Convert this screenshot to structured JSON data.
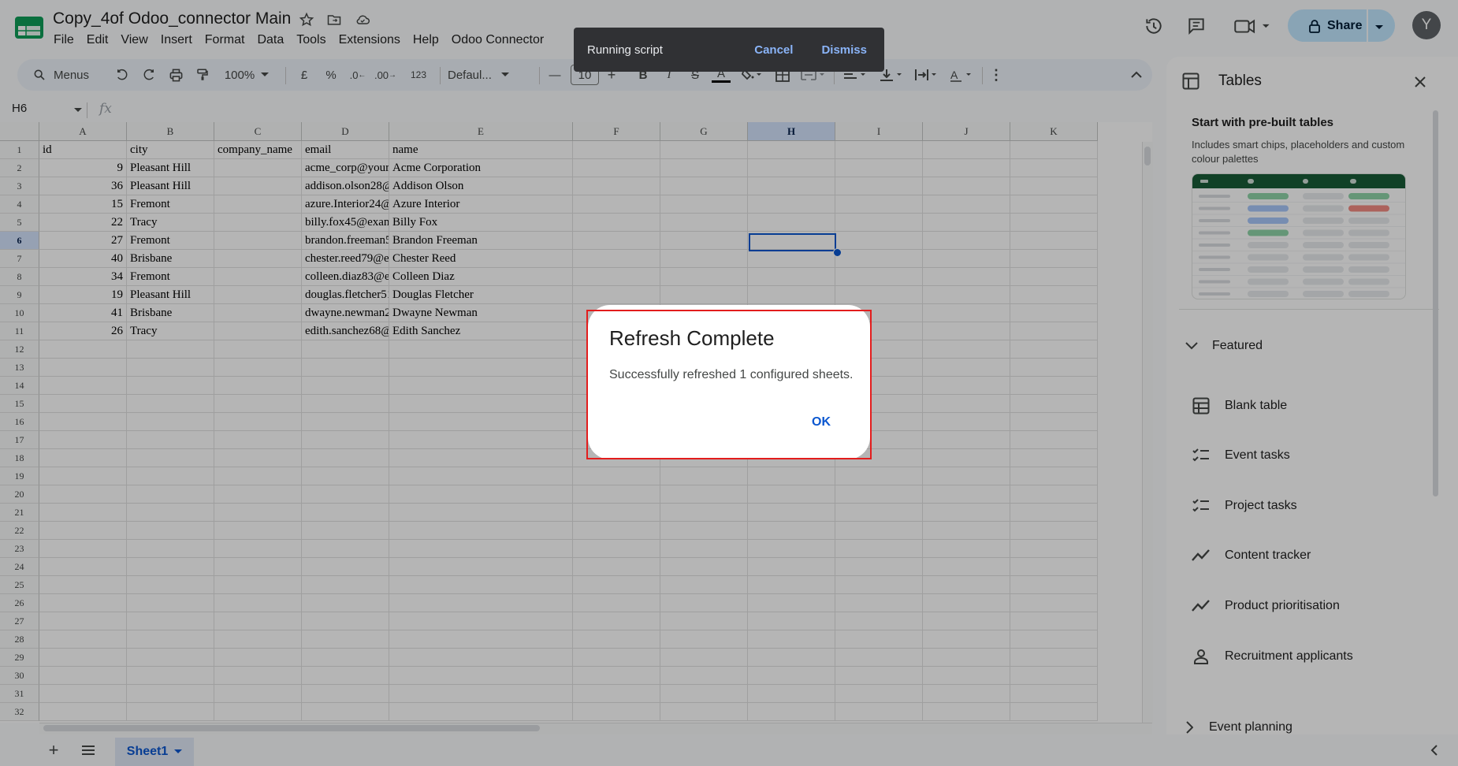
{
  "app": {
    "title": "Copy_4of Odoo_connector Main",
    "menus": [
      "File",
      "Edit",
      "View",
      "Insert",
      "Format",
      "Data",
      "Tools",
      "Extensions",
      "Help",
      "Odoo Connector"
    ],
    "share_label": "Share",
    "avatar_initial": "Y",
    "accent": "#0b57d0"
  },
  "toolbar": {
    "search_label": "Menus",
    "zoom": "100%",
    "currency": "£",
    "percent": "%",
    "dec_decrease": ".0",
    "dec_increase": ".00",
    "number_format": "123",
    "font_name": "Defaul...",
    "font_size": "10"
  },
  "formula_bar": {
    "name_box": "H6",
    "fx": "fx"
  },
  "grid": {
    "columns": [
      "A",
      "B",
      "C",
      "D",
      "E",
      "F",
      "G",
      "H",
      "I",
      "J",
      "K"
    ],
    "selected_column": "H",
    "selected_row": "6",
    "rows": [
      [
        "id",
        "city",
        "company_name",
        "email",
        "name"
      ],
      [
        "9",
        "Pleasant Hill",
        "",
        "acme_corp@your",
        "Acme Corporation"
      ],
      [
        "36",
        "Pleasant Hill",
        "",
        "addison.olson28@",
        "Addison Olson"
      ],
      [
        "15",
        "Fremont",
        "",
        "azure.Interior24@",
        "Azure Interior"
      ],
      [
        "22",
        "Tracy",
        "",
        "billy.fox45@exam",
        "Billy Fox"
      ],
      [
        "27",
        "Fremont",
        "",
        "brandon.freeman5",
        "Brandon Freeman"
      ],
      [
        "40",
        "Brisbane",
        "",
        "chester.reed79@e:",
        "Chester Reed"
      ],
      [
        "34",
        "Fremont",
        "",
        "colleen.diaz83@e:",
        "Colleen Diaz"
      ],
      [
        "19",
        "Pleasant Hill",
        "",
        "douglas.fletcher51",
        "Douglas Fletcher"
      ],
      [
        "41",
        "Brisbane",
        "",
        "dwayne.newman2",
        "Dwayne Newman"
      ],
      [
        "26",
        "Tracy",
        "",
        "edith.sanchez68@",
        "Edith Sanchez"
      ]
    ],
    "row_numbers": [
      "1",
      "2",
      "3",
      "4",
      "5",
      "6",
      "7",
      "8",
      "9",
      "10",
      "11",
      "12",
      "13",
      "14",
      "15",
      "16",
      "17",
      "18",
      "19",
      "20",
      "21",
      "22",
      "23",
      "24",
      "25",
      "26",
      "27",
      "28",
      "29",
      "30",
      "31",
      "32"
    ]
  },
  "bottom": {
    "sheet_tab": "Sheet1"
  },
  "side_panel": {
    "title": "Tables",
    "heading": "Start with pre-built tables",
    "description": "Includes smart chips, placeholders and custom colour palettes",
    "featured_label": "Featured",
    "items": [
      {
        "label": "Blank table",
        "icon": "table-icon"
      },
      {
        "label": "Event tasks",
        "icon": "checklist-icon"
      },
      {
        "label": "Project tasks",
        "icon": "checklist-icon"
      },
      {
        "label": "Content tracker",
        "icon": "trend-icon"
      },
      {
        "label": "Product prioritisation",
        "icon": "trend-icon"
      },
      {
        "label": "Recruitment applicants",
        "icon": "person-icon"
      }
    ],
    "next_section": "Event planning"
  },
  "snackbar": {
    "text": "Running script",
    "cancel": "Cancel",
    "dismiss": "Dismiss"
  },
  "dialog": {
    "title": "Refresh Complete",
    "body": "Successfully refreshed 1 configured sheets.",
    "ok": "OK"
  }
}
